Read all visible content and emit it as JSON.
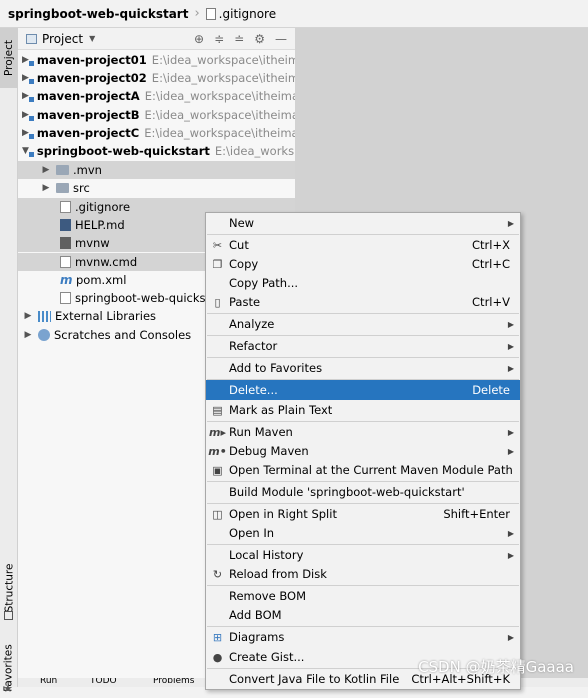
{
  "breadcrumb": {
    "project": "springboot-web-quickstart",
    "file": ".gitignore"
  },
  "sidebar_tabs": {
    "project": "Project",
    "structure": "Structure",
    "favorites": "Favorites"
  },
  "panel": {
    "title": "Project"
  },
  "tree": {
    "modules": [
      {
        "name": "maven-project01",
        "path": "E:\\idea_workspace\\itheim"
      },
      {
        "name": "maven-project02",
        "path": "E:\\idea_workspace\\itheim"
      },
      {
        "name": "maven-projectA",
        "path": "E:\\idea_workspace\\itheima"
      },
      {
        "name": "maven-projectB",
        "path": "E:\\idea_workspace\\itheima"
      },
      {
        "name": "maven-projectC",
        "path": "E:\\idea_workspace\\itheima"
      },
      {
        "name": "springboot-web-quickstart",
        "path": "E:\\idea_workspa"
      }
    ],
    "children": {
      "mvn": ".mvn",
      "src": "src",
      "gitignore": ".gitignore",
      "help": "HELP.md",
      "mvnw": "mvnw",
      "mvnw_cmd": "mvnw.cmd",
      "pom": "pom.xml",
      "iml": "springboot-web-quickstart"
    },
    "external": "External Libraries",
    "scratches": "Scratches and Consoles"
  },
  "context_menu": {
    "new": "New",
    "cut": "Cut",
    "cut_sc": "Ctrl+X",
    "copy": "Copy",
    "copy_sc": "Ctrl+C",
    "copy_path": "Copy Path...",
    "paste": "Paste",
    "paste_sc": "Ctrl+V",
    "analyze": "Analyze",
    "refactor": "Refactor",
    "favorites": "Add to Favorites",
    "delete": "Delete...",
    "delete_sc": "Delete",
    "plain_text": "Mark as Plain Text",
    "run_maven": "Run Maven",
    "debug_maven": "Debug Maven",
    "terminal": "Open Terminal at the Current Maven Module Path",
    "build_module": "Build Module 'springboot-web-quickstart'",
    "right_split": "Open in Right Split",
    "right_split_sc": "Shift+Enter",
    "open_in": "Open In",
    "local_history": "Local History",
    "reload": "Reload from Disk",
    "remove_bom": "Remove BOM",
    "add_bom": "Add BOM",
    "diagrams": "Diagrams",
    "gist": "Create Gist...",
    "kotlin": "Convert Java File to Kotlin File",
    "kotlin_sc": "Ctrl+Alt+Shift+K"
  },
  "bottom_tabs": {
    "run": "Run",
    "todo": "TODO",
    "problems": "Problems"
  },
  "watermark": "CSDN @奶茶精Gaaaa",
  "colors": {
    "highlight": "#2675bf",
    "selection": "#d4d4d4"
  }
}
